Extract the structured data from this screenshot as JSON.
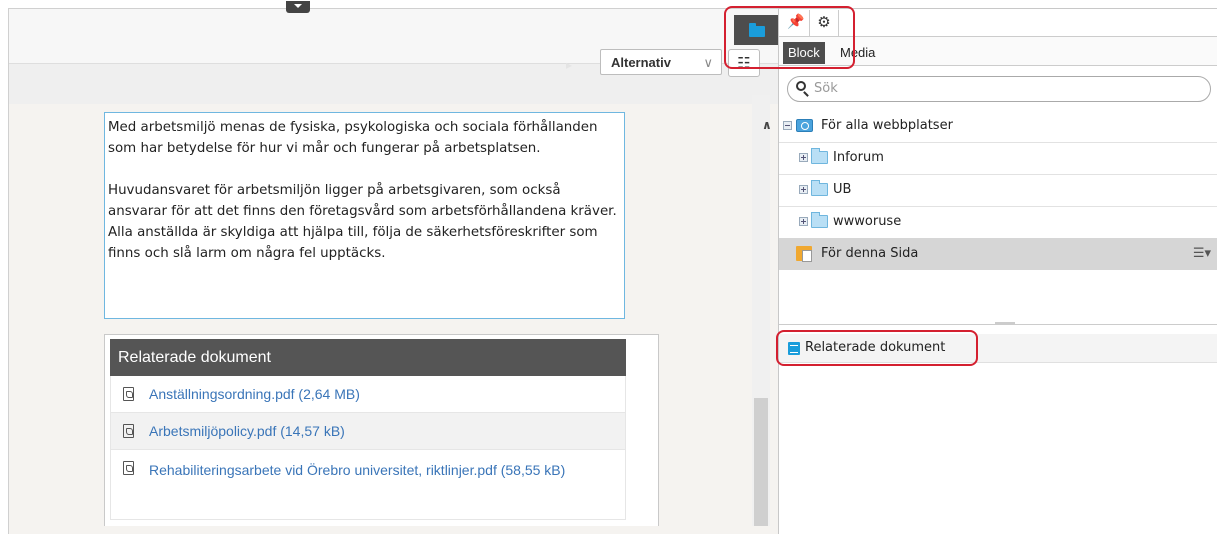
{
  "editor": {
    "alternatives_label": "Alternativ",
    "alternatives_chevron": "∨",
    "list_icon_glyph": "☷",
    "paragraph1": "Med arbetsmiljö menas de fysiska, psykologiska och sociala förhållanden som har betydelse för hur vi mår och fungerar på arbetsplatsen.",
    "paragraph2": "Huvudansvaret för arbetsmiljön ligger på arbetsgivaren, som också ansvarar för att det finns den företagsvård som arbetsförhållandena kräver. Alla anställda är skyldiga att hjälpa till, följa de säkerhetsföreskrifter som finns och slå larm om några fel upptäcks.",
    "related": {
      "heading": "Relaterade dokument",
      "documents": [
        {
          "name": "Anställningsordning.pdf (2,64 MB)"
        },
        {
          "name": "Arbetsmiljöpolicy.pdf (14,57 kB)"
        },
        {
          "name": "Rehabiliteringsarbete vid Örebro universitet, riktlinjer.pdf (58,55 kB)"
        }
      ]
    }
  },
  "panel": {
    "tabs": {
      "pin_glyph": "📌",
      "gear_glyph": "⚙",
      "block": "Block",
      "media": "Media"
    },
    "search_placeholder": "Sök",
    "tree": {
      "root": "För alla webbplatser",
      "children": [
        "Inforum",
        "UB",
        "wwworuse"
      ],
      "current": "För denna Sida",
      "current_menu_glyph": "☰▾"
    },
    "blocks": [
      {
        "name": "Relaterade dokument"
      }
    ]
  },
  "colors": {
    "accent": "#1a9ddb",
    "highlight": "#d42030",
    "link": "#3a75b8",
    "header_dark": "#555555"
  }
}
